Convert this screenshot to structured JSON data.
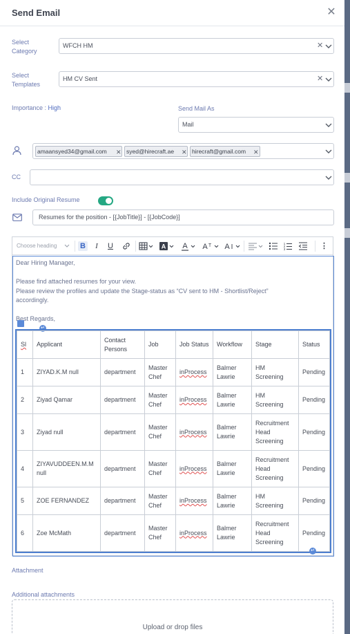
{
  "modal": {
    "title": "Send Email"
  },
  "form": {
    "category_label": "Select Category",
    "category_value": "WFCH HM",
    "templates_label": "Select Templates",
    "templates_value": "HM CV Sent",
    "importance_label": "Importance :",
    "importance_value": "High",
    "send_as_label": "Send Mail As",
    "send_as_value": "Mail",
    "to_recipients": [
      "amaansyed34@gmail.com",
      "syed@hirecraft.ae",
      "hirecraft@gmail.com"
    ],
    "cc_label": "CC",
    "cc_value": "",
    "include_resume_label": "Include Original Resume",
    "include_resume_on": true,
    "subject": "Resumes for the position  - [{JobTitle}] - [{JobCode}]"
  },
  "toolbar": {
    "heading_placeholder": "Choose heading"
  },
  "body": {
    "greeting": "Dear Hiring Manager,",
    "line1": "Please find attached resumes for your view.",
    "line2": "Please review the profiles and update the Stage-status as “CV sent to HM - Shortlist/Reject”",
    "line3": "accordingly.",
    "regards": "Best Regards,"
  },
  "table": {
    "headers": [
      "Sl",
      "Applicant",
      "Contact Persons",
      "Job",
      "Job Status",
      "Workflow",
      "Stage",
      "Status"
    ],
    "rows": [
      [
        "1",
        "ZIYAD.K.M null",
        "department",
        "Master Chef",
        "inProcess",
        "Balmer Lawrie",
        "HM Screening",
        "Pending"
      ],
      [
        "2",
        "Ziyad Qamar",
        "department",
        "Master Chef",
        "inProcess",
        "Balmer Lawrie",
        "HM Screening",
        "Pending"
      ],
      [
        "3",
        "Ziyad null",
        "department",
        "Master Chef",
        "inProcess",
        "Balmer Lawrie",
        "Recruitment Head Screening",
        "Pending"
      ],
      [
        "4",
        "ZIYAVUDDEEN.M.M null",
        "department",
        "Master Chef",
        "inProcess",
        "Balmer Lawrie",
        "Recruitment Head Screening",
        "Pending"
      ],
      [
        "5",
        "ZOE FERNANDEZ",
        "department",
        "Master Chef",
        "inProcess",
        "Balmer Lawrie",
        "HM Screening",
        "Pending"
      ],
      [
        "6",
        "Zoe McMath",
        "department",
        "Master Chef",
        "inProcess",
        "Balmer Lawrie",
        "Recruitment Head Screening",
        "Pending"
      ]
    ]
  },
  "attachments": {
    "attachment_label": "Attachment",
    "additional_label": "Additional attachments",
    "upload_text": "Upload or drop files"
  },
  "colors": {
    "toggle": "#25a883",
    "label": "#6c7ab0",
    "selection": "#4d7fcf"
  }
}
